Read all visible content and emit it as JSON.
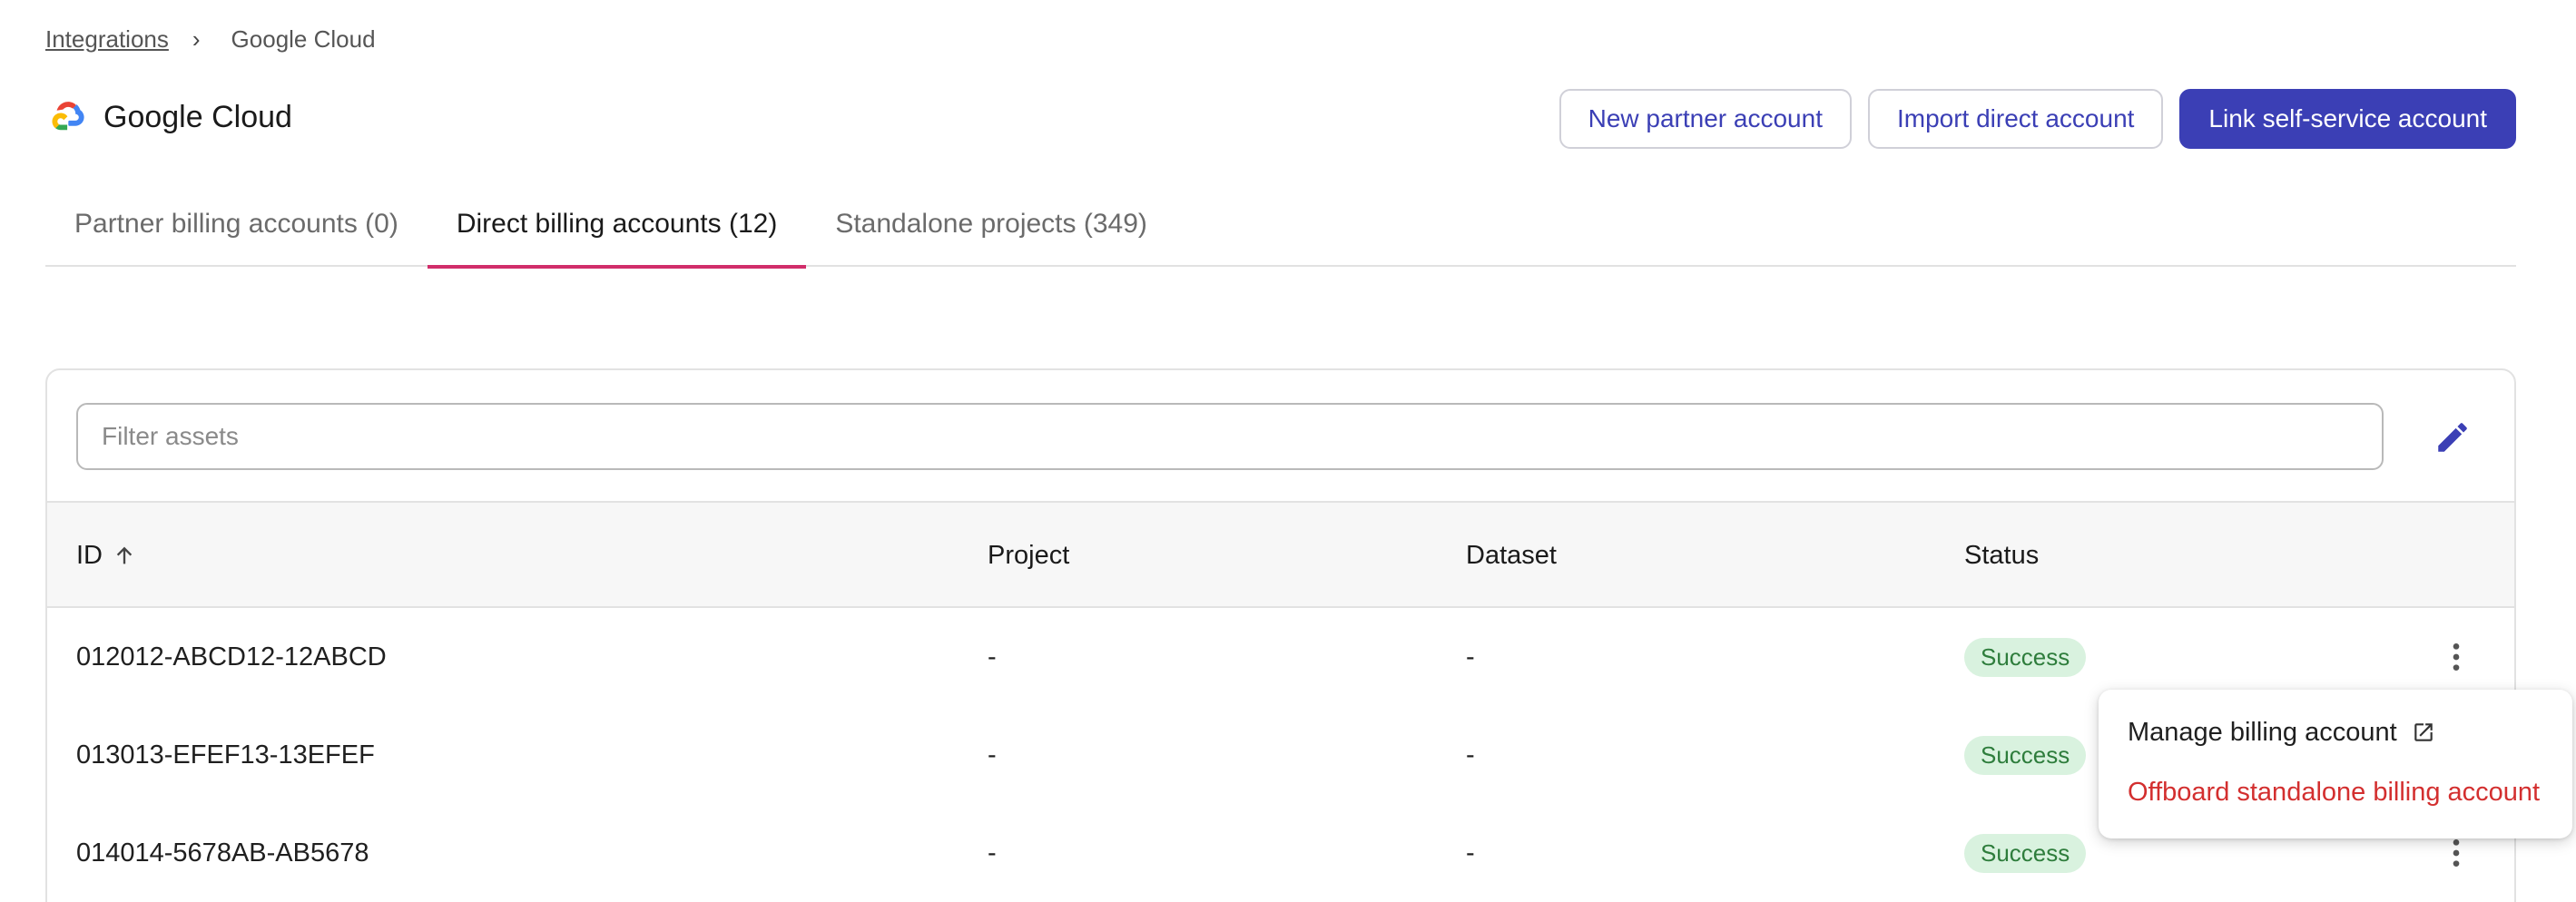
{
  "breadcrumb": {
    "parent": "Integrations",
    "separator": "›",
    "current": "Google Cloud"
  },
  "header": {
    "title": "Google Cloud",
    "logo_icon": "google-cloud-logo"
  },
  "actions": {
    "new_partner": "New partner account",
    "import_direct": "Import direct account",
    "link_self_service": "Link self-service account"
  },
  "tabs": [
    {
      "label": "Partner billing accounts (0)",
      "active": false
    },
    {
      "label": "Direct billing accounts (12)",
      "active": true
    },
    {
      "label": "Standalone projects (349)",
      "active": false
    }
  ],
  "filter": {
    "placeholder": "Filter assets",
    "edit_icon": "pencil-icon"
  },
  "table": {
    "columns": [
      "ID",
      "Project",
      "Dataset",
      "Status"
    ],
    "sort": {
      "column": "ID",
      "direction": "ascending"
    },
    "rows": [
      {
        "id": "012012-ABCD12-12ABCD",
        "project": "-",
        "dataset": "-",
        "status": "Success"
      },
      {
        "id": "013013-EFEF13-13EFEF",
        "project": "-",
        "dataset": "-",
        "status": "Success"
      },
      {
        "id": "014014-5678AB-AB5678",
        "project": "-",
        "dataset": "-",
        "status": "Success"
      }
    ]
  },
  "menu": {
    "manage": "Manage billing account",
    "offboard": "Offboard standalone billing account"
  },
  "colors": {
    "primary": "#3b3fb5",
    "tab_indicator": "#d12d6a",
    "success_bg": "#d9f2df",
    "success_text": "#2e7d3c",
    "danger": "#d32f2f"
  }
}
